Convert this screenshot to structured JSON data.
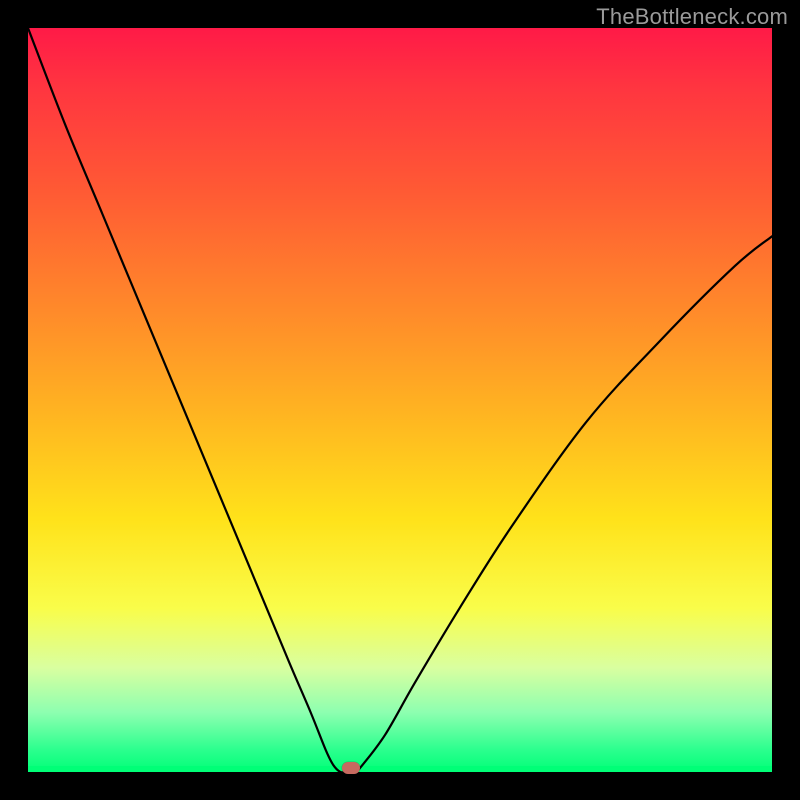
{
  "watermark": "TheBottleneck.com",
  "chart_data": {
    "type": "line",
    "title": "",
    "xlabel": "",
    "ylabel": "",
    "xlim": [
      0,
      100
    ],
    "ylim": [
      0,
      100
    ],
    "grid": false,
    "series": [
      {
        "name": "curve",
        "x": [
          0,
          5,
          10,
          15,
          20,
          25,
          30,
          35,
          38,
          40,
          41,
          42,
          43,
          44,
          45,
          48,
          52,
          58,
          65,
          75,
          85,
          95,
          100
        ],
        "y": [
          100,
          87,
          75,
          63,
          51,
          39,
          27,
          15,
          8,
          3,
          1,
          0,
          0,
          0,
          1,
          5,
          12,
          22,
          33,
          47,
          58,
          68,
          72
        ]
      }
    ],
    "marker": {
      "x": 43.4,
      "y": 0.6,
      "color": "#c76a60"
    },
    "gradient_bands": [
      {
        "y": 100,
        "color": "#ff1a47"
      },
      {
        "y": 50,
        "color": "#ffb521"
      },
      {
        "y": 25,
        "color": "#ffe21a"
      },
      {
        "y": 5,
        "color": "#8dffb0"
      },
      {
        "y": 0,
        "color": "#00ff77"
      }
    ]
  }
}
